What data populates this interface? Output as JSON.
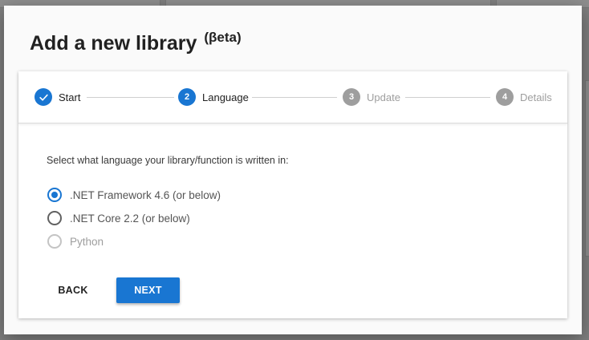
{
  "dialog": {
    "title": "Add a new library",
    "title_suffix": "(βeta)"
  },
  "stepper": {
    "steps": [
      {
        "number": "",
        "label": "Start",
        "state": "done",
        "icon": "check-icon"
      },
      {
        "number": "2",
        "label": "Language",
        "state": "active"
      },
      {
        "number": "3",
        "label": "Update",
        "state": "pending"
      },
      {
        "number": "4",
        "label": "Details",
        "state": "pending"
      }
    ]
  },
  "language": {
    "prompt": "Select what language your library/function is written in:",
    "options": [
      {
        "label": ".NET Framework 4.6 (or below)",
        "checked": true,
        "disabled": false
      },
      {
        "label": ".NET Core 2.2 (or below)",
        "checked": false,
        "disabled": false
      },
      {
        "label": "Python",
        "checked": false,
        "disabled": true
      }
    ]
  },
  "actions": {
    "back_label": "BACK",
    "next_label": "NEXT"
  },
  "colors": {
    "primary": "#1976d2",
    "pending": "#9e9e9e",
    "backdrop": "#7f7f7f"
  }
}
